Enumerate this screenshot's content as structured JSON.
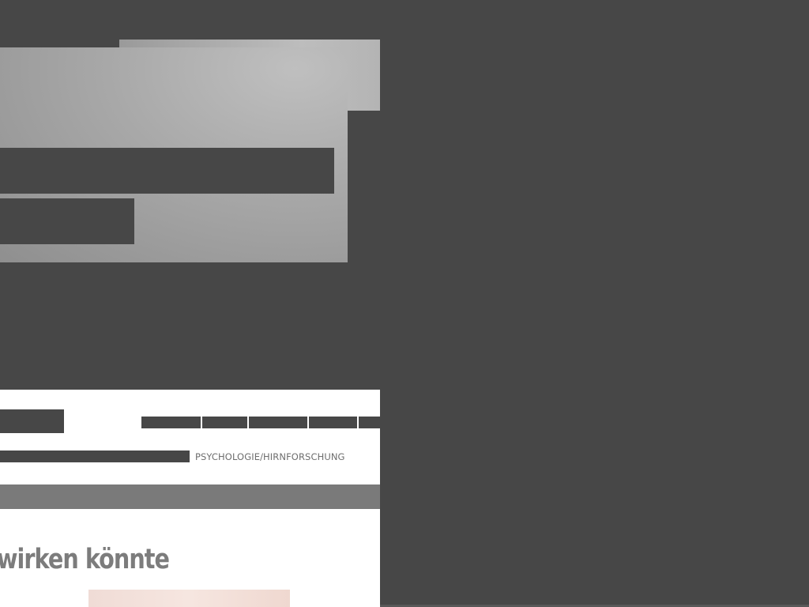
{
  "overlay": {
    "theme_color": "#474747"
  },
  "site": {
    "category_label": "PSYCHOLOGIE/HIRNFORSCHUNG",
    "headline": "wirken könnte",
    "nav_items": [
      {
        "id": "nav-1"
      },
      {
        "id": "nav-2"
      },
      {
        "id": "nav-3"
      },
      {
        "id": "nav-4"
      },
      {
        "id": "nav-5"
      }
    ]
  }
}
